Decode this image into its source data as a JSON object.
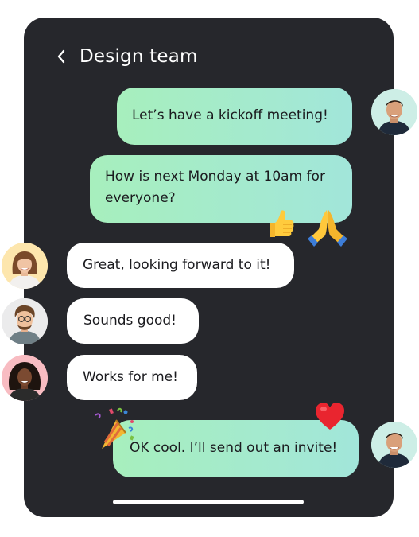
{
  "header": {
    "title": "Design team",
    "back_icon": "chevron-left-icon"
  },
  "messages": [
    {
      "sender": "me",
      "text": "Let’s have a kickoff meeting!"
    },
    {
      "sender": "me",
      "text": "How is next Monday at 10am for everyone?",
      "reactions": [
        "thumbs-up-icon",
        "praying-hands-icon"
      ]
    },
    {
      "sender": "participant-1",
      "text": "Great, looking forward to it!"
    },
    {
      "sender": "participant-2",
      "text": "Sounds good!"
    },
    {
      "sender": "participant-3",
      "text": "Works for me!"
    },
    {
      "sender": "me",
      "text": "OK cool. I’ll send out an invite!",
      "reactions": [
        "party-popper-icon",
        "red-heart-icon"
      ]
    }
  ],
  "colors": {
    "panel": "#26272c",
    "outgoing_bubble_start": "#a7efbd",
    "outgoing_bubble_end": "#a2e6da",
    "incoming_bubble": "#ffffff",
    "text": "#1b1b1f"
  }
}
